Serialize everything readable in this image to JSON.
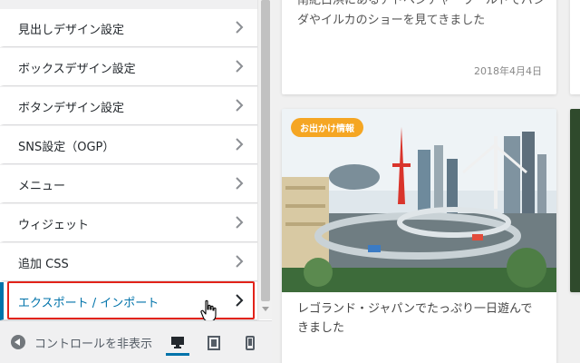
{
  "sidebar": {
    "items": [
      {
        "label": "見出しデザイン設定"
      },
      {
        "label": "ボックスデザイン設定"
      },
      {
        "label": "ボタンデザイン設定"
      },
      {
        "label": "SNS設定（OGP）"
      },
      {
        "label": "メニュー"
      },
      {
        "label": "ウィジェット"
      },
      {
        "label": "追加 CSS"
      },
      {
        "label": "エクスポート / インポート"
      }
    ],
    "active_index": 7
  },
  "footer": {
    "collapse_label": "コントロールを非表示",
    "devices": [
      "desktop-icon",
      "tablet-icon",
      "mobile-icon"
    ],
    "active_device": "desktop"
  },
  "preview": {
    "top_card": {
      "excerpt": "南紀白浜にあるアドベンチャーワールドでパンダやイルカのショーを見てきました",
      "date": "2018年4月4日"
    },
    "main_card": {
      "badge": "お出かけ情報",
      "title": "レゴランド・ジャパンでたっぷり一日遊んできました"
    }
  },
  "colors": {
    "accent": "#0073aa",
    "highlight_border": "#e2231a",
    "badge": "#f5a623"
  }
}
